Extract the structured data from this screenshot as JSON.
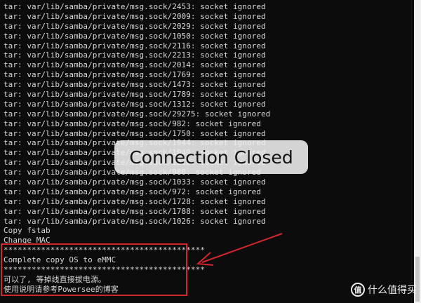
{
  "terminal": {
    "lines": [
      "tar: var/lib/samba/private/msg.sock/2453: socket ignored",
      "tar: var/lib/samba/private/msg.sock/2009: socket ignored",
      "tar: var/lib/samba/private/msg.sock/2029: socket ignored",
      "tar: var/lib/samba/private/msg.sock/1050: socket ignored",
      "tar: var/lib/samba/private/msg.sock/2116: socket ignored",
      "tar: var/lib/samba/private/msg.sock/2213: socket ignored",
      "tar: var/lib/samba/private/msg.sock/2014: socket ignored",
      "tar: var/lib/samba/private/msg.sock/1769: socket ignored",
      "tar: var/lib/samba/private/msg.sock/1473: socket ignored",
      "tar: var/lib/samba/private/msg.sock/1789: socket ignored",
      "tar: var/lib/samba/private/msg.sock/1312: socket ignored",
      "tar: var/lib/samba/private/msg.sock/29275: socket ignored",
      "tar: var/lib/samba/private/msg.sock/982: socket ignored",
      "tar: var/lib/samba/private/msg.sock/1750: socket ignored",
      "tar: var/lib/samba/private/msg.sock/1944: socket ignored",
      "tar: var/lib/samba/private/msg.sock/1049: socket ignored",
      "tar: var/lib/samba/private/msg.sock/1212: socket ignored",
      "tar: var/lib/samba/private/msg.sock/980: socket ignored",
      "tar: var/lib/samba/private/msg.sock/1033: socket ignored",
      "tar: var/lib/samba/private/msg.sock/972: socket ignored",
      "tar: var/lib/samba/private/msg.sock/1728: socket ignored",
      "tar: var/lib/samba/private/msg.sock/1788: socket ignored",
      "tar: var/lib/samba/private/msg.sock/1026: socket ignored",
      "Copy fstab",
      "Change MAC",
      "*******************************************",
      "Complete copy OS to eMMC",
      "*******************************************",
      "可以了, 等掉线直接拔电源。",
      "使用说明请参考Powersee的博客"
    ]
  },
  "toast": {
    "message": "Connection Closed"
  },
  "watermark": {
    "logo_char": "值",
    "text": "什么值得买"
  },
  "colors": {
    "background": "#0c0c0c",
    "text": "#d8d8d8",
    "annotation": "#d0262d"
  }
}
